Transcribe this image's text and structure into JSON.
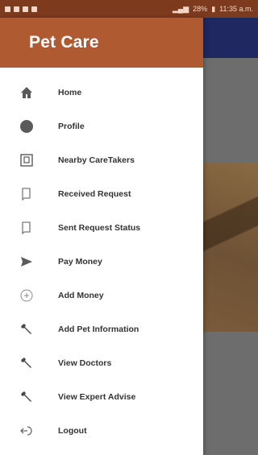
{
  "statusbar": {
    "battery": "28%",
    "time": "11:35 a.m."
  },
  "drawer": {
    "title": "Pet Care",
    "header_color": "#b05a32",
    "items": [
      {
        "label": "Home",
        "icon": "home-icon"
      },
      {
        "label": "Profile",
        "icon": "profile-icon"
      },
      {
        "label": "Nearby CareTakers",
        "icon": "nearby-caretakers-icon"
      },
      {
        "label": "Received Request",
        "icon": "received-request-icon"
      },
      {
        "label": "Sent Request Status",
        "icon": "sent-request-icon"
      },
      {
        "label": "Pay Money",
        "icon": "send-icon"
      },
      {
        "label": "Add Money",
        "icon": "add-circle-icon"
      },
      {
        "label": "Add Pet Information",
        "icon": "wrench-icon"
      },
      {
        "label": "View Doctors",
        "icon": "wrench-icon"
      },
      {
        "label": "View Expert Advise",
        "icon": "wrench-icon"
      },
      {
        "label": "Logout",
        "icon": "logout-icon"
      }
    ]
  }
}
